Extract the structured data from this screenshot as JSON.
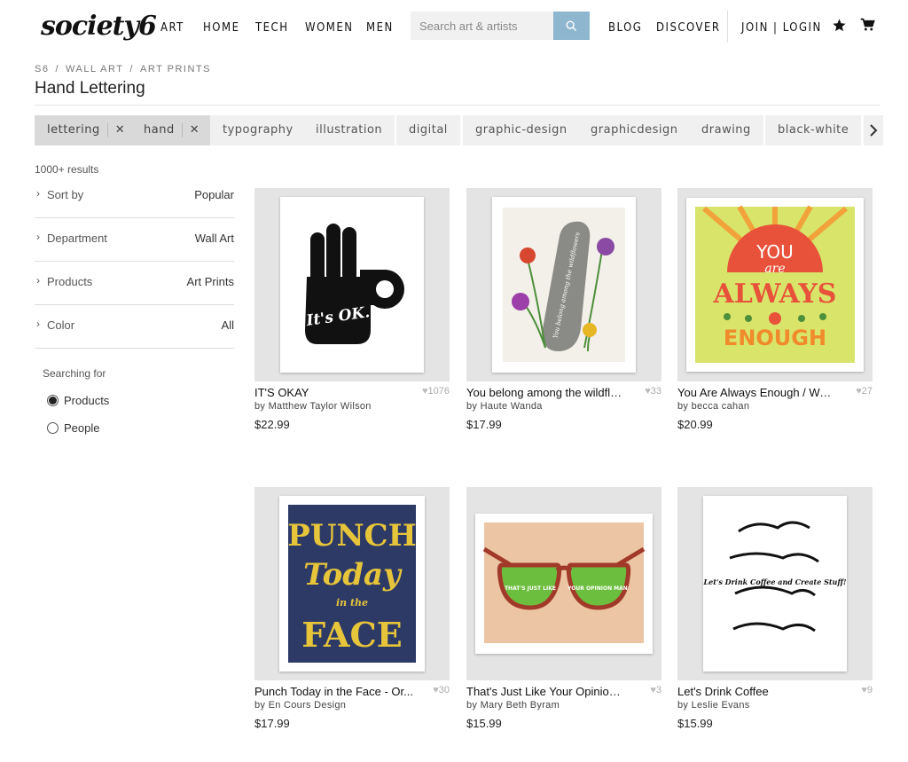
{
  "header": {
    "logo": "society6",
    "nav": [
      "ART",
      "HOME",
      "TECH",
      "WOMEN",
      "MEN"
    ],
    "search_placeholder": "Search art & artists",
    "right_nav": [
      "BLOG",
      "DISCOVER"
    ],
    "join_login": "JOIN | LOGIN"
  },
  "breadcrumb": [
    "S6",
    "WALL ART",
    "ART PRINTS"
  ],
  "page_title": "Hand Lettering",
  "tags": [
    {
      "label": "lettering",
      "active": true
    },
    {
      "label": "hand",
      "active": true
    },
    {
      "label": "typography",
      "active": false
    },
    {
      "label": "illustration",
      "active": false
    },
    {
      "label": "digital",
      "active": false
    },
    {
      "label": "graphic-design",
      "active": false
    },
    {
      "label": "graphicdesign",
      "active": false
    },
    {
      "label": "drawing",
      "active": false
    },
    {
      "label": "black-white",
      "active": false
    }
  ],
  "sidebar": {
    "results_count": "1000+ results",
    "filters": [
      {
        "name": "Sort by",
        "value": "Popular"
      },
      {
        "name": "Department",
        "value": "Wall Art"
      },
      {
        "name": "Products",
        "value": "Art Prints"
      },
      {
        "name": "Color",
        "value": "All"
      }
    ],
    "searching_for": "Searching for",
    "options": [
      {
        "label": "Products",
        "checked": true
      },
      {
        "label": "People",
        "checked": false
      }
    ]
  },
  "products": [
    {
      "title": "IT'S OKAY",
      "likes": "1076",
      "artist": "by Matthew Taylor Wilson",
      "price": "$22.99",
      "art_text": "It's OK."
    },
    {
      "title": "You belong among the wildflo...",
      "likes": "33",
      "artist": "by Haute Wanda",
      "price": "$17.99",
      "art_text": "You belong among the wildflowers"
    },
    {
      "title": "You Are Always Enough / Wat...",
      "likes": "27",
      "artist": "by becca cahan",
      "price": "$20.99",
      "art_text_1": "YOU",
      "art_text_2": "are",
      "art_text_3": "ALWAYS",
      "art_text_4": "ENOUGH"
    },
    {
      "title": "Punch Today in the Face - Or...",
      "likes": "30",
      "artist": "by En Cours Design",
      "price": "$17.99",
      "art_text_1": "PUNCH",
      "art_text_2": "Today",
      "art_text_3": "in the",
      "art_text_4": "FACE"
    },
    {
      "title": "That's Just Like Your Opinion, ...",
      "likes": "3",
      "artist": "by Mary Beth Byram",
      "price": "$15.99",
      "art_text_1": "THAT'S JUST LIKE",
      "art_text_2": "YOUR OPINION MAN"
    },
    {
      "title": "Let's Drink Coffee",
      "likes": "9",
      "artist": "by Leslie Evans",
      "price": "$15.99",
      "art_text": "Let's Drink Coffee and Create Stuff!"
    }
  ]
}
